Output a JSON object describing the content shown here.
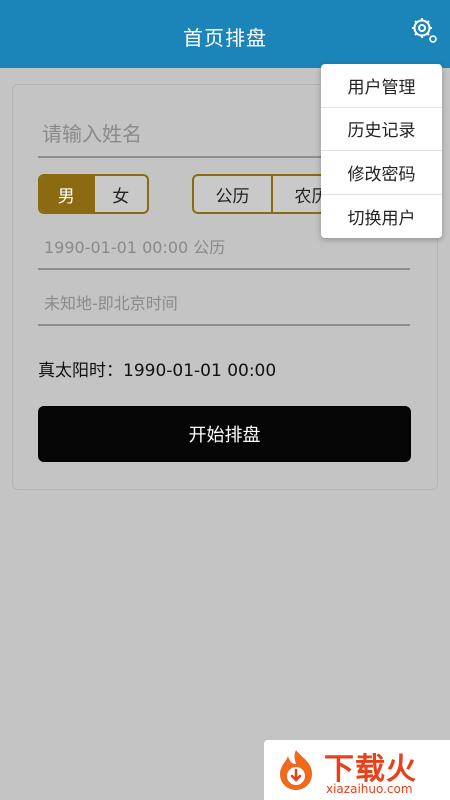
{
  "header": {
    "title": "首页排盘",
    "settings_icon": "gear-icon"
  },
  "form": {
    "name_placeholder": "请输入姓名",
    "gender_options": [
      "男",
      "女"
    ],
    "gender_selected": "男",
    "calendar_options": [
      "公历",
      "农历"
    ],
    "date_value": "1990-01-01 00:00 公历",
    "place_value": "未知地-即北京时间",
    "true_solar_time": "真太阳时：1990-01-01 00:00",
    "start_button": "开始排盘"
  },
  "menu": {
    "items": [
      "用户管理",
      "历史记录",
      "修改密码",
      "切换用户"
    ]
  },
  "watermark": {
    "brand_text": "下载火",
    "domain": "xiazaihuo.com"
  },
  "colors": {
    "header_bg": "#1b84b8",
    "accent": "#8b6a12",
    "button_bg": "#050505",
    "watermark": "#e8401a"
  }
}
